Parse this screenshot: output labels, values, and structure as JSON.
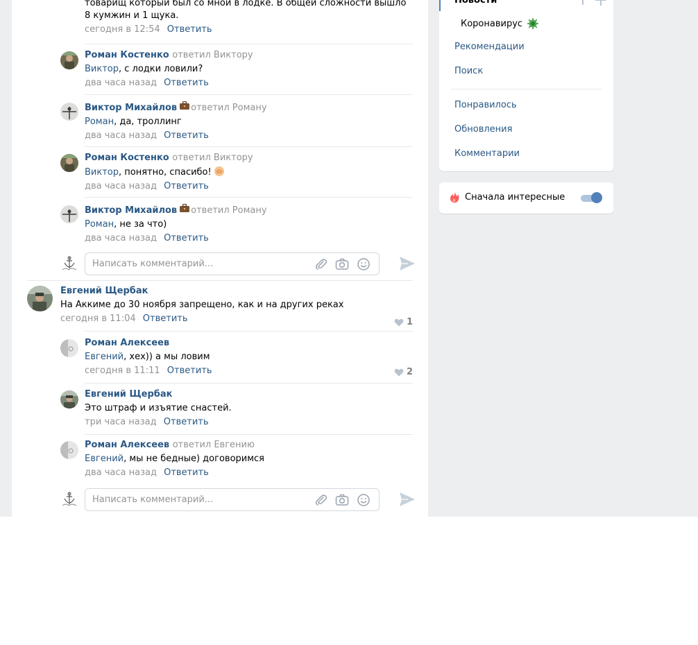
{
  "comments": [
    {
      "id": "c0",
      "text": "товарищ который был со мной в лодке. В общей сложности вышло 8 кумжин и 1 щука.",
      "date": "сегодня в 12:54",
      "reply_label": "Ответить"
    },
    {
      "id": "c1",
      "author": "Роман Костенко",
      "reply_to": "ответил Виктору",
      "mention": "Виктор",
      "text": ", с лодки ловили?",
      "date": "два часа назад",
      "reply_label": "Ответить"
    },
    {
      "id": "c2",
      "author": "Виктор Михайлов",
      "reply_to": "ответил Роману",
      "mention": "Роман",
      "text": ", да, троллинг",
      "date": "два часа назад",
      "reply_label": "Ответить"
    },
    {
      "id": "c3",
      "author": "Роман Костенко",
      "reply_to": "ответил Виктору",
      "mention": "Виктор",
      "text": ", понятно, спасибо!",
      "date": "два часа назад",
      "reply_label": "Ответить"
    },
    {
      "id": "c4",
      "author": "Виктор Михайлов",
      "reply_to": "ответил Роману",
      "mention": "Роман",
      "text": ", не за что)",
      "date": "два часа назад",
      "reply_label": "Ответить"
    },
    {
      "id": "c5",
      "author": "Евгений Щербак",
      "text": "На Аккиме до 30 ноября запрещено, как и на других реках",
      "date": "сегодня в 11:04",
      "reply_label": "Ответить",
      "likes": "1"
    },
    {
      "id": "c6",
      "author": "Роман Алексеев",
      "mention": "Евгений",
      "text": ", хех)) а мы ловим",
      "date": "сегодня в 11:11",
      "reply_label": "Ответить",
      "likes": "2"
    },
    {
      "id": "c7",
      "author": "Евгений Щербак",
      "text": "Это штраф и изъятие снастей.",
      "date": "три часа назад",
      "reply_label": "Ответить"
    },
    {
      "id": "c8",
      "author": "Роман Алексеев",
      "reply_to": "ответил Евгению",
      "mention": "Евгений",
      "text": ", мы не бедные) договоримся",
      "date": "два часа назад",
      "reply_label": "Ответить"
    }
  ],
  "composer": {
    "placeholder": "Написать комментарий..."
  },
  "sidebar": {
    "top_item": "Новости",
    "sub_item": "Коронавирус",
    "items": [
      "Рекомендации",
      "Поиск",
      "Понравилось",
      "Обновления",
      "Комментарии"
    ]
  },
  "filter": {
    "label": "Сначала интересные",
    "enabled": true
  },
  "colors": {
    "link": "#2a5885",
    "muted": "#939393",
    "accent": "#5181b8",
    "page_bg": "#edeef0"
  }
}
